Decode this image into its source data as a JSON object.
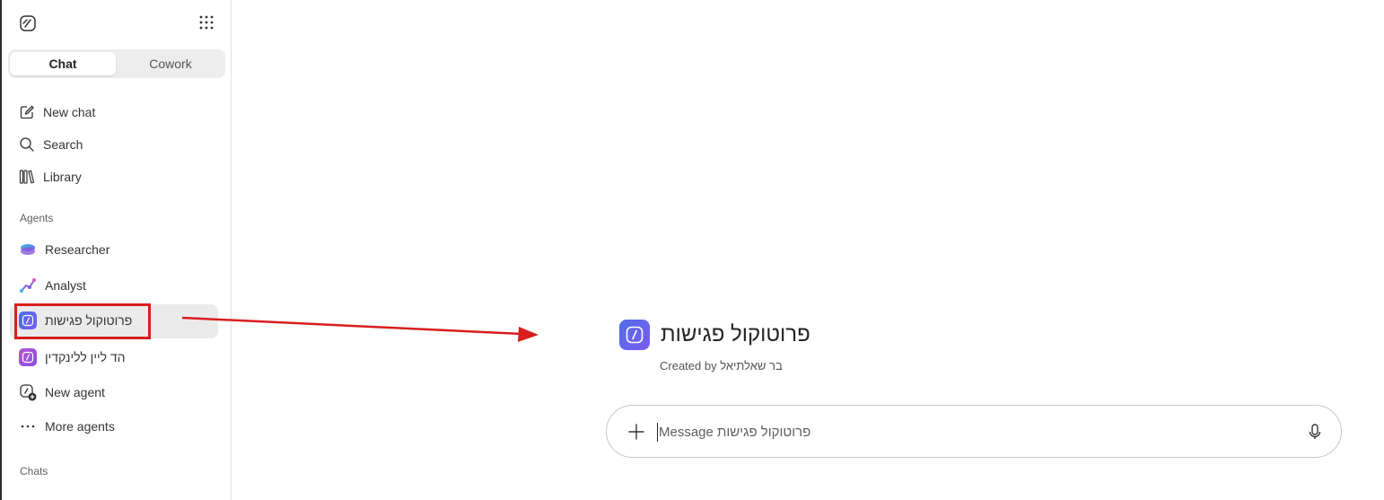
{
  "sidebar": {
    "tabs": [
      {
        "label": "Chat",
        "active": true
      },
      {
        "label": "Cowork",
        "active": false
      }
    ],
    "nav": {
      "new_chat": "New chat",
      "search": "Search",
      "library": "Library"
    },
    "agents_header": "Agents",
    "agents": [
      {
        "label": "Researcher",
        "icon": "researcher-icon"
      },
      {
        "label": "Analyst",
        "icon": "analyst-icon"
      },
      {
        "label": "פרוטוקול פגישות",
        "icon": "agent-badge-icon",
        "selected": true,
        "color": "#5b6ee8"
      },
      {
        "label": "הד ליין ללינקדין",
        "icon": "agent-badge-icon",
        "color": "#b455d6"
      },
      {
        "label": "New agent",
        "icon": "new-agent-icon"
      },
      {
        "label": "More agents",
        "icon": "more-icon"
      }
    ],
    "chats_header": "Chats"
  },
  "main": {
    "agent_name": "פרוטוקול פגישות",
    "created_by_label": "Created by",
    "created_by_name": "בר שאלתיאל",
    "composer": {
      "placeholder": "Message פרוטוקול פגישות"
    }
  },
  "colors": {
    "highlight_red": "#d81e1e",
    "agent_gradient_start": "#4f6de8",
    "agent_gradient_end": "#7b5cf0"
  }
}
